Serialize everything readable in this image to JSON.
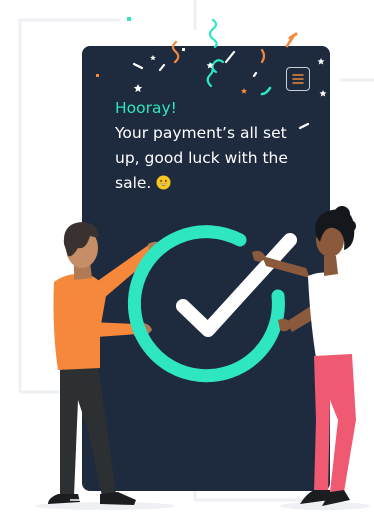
{
  "message": {
    "heading": "Hooray!",
    "body": "Your payment’s all set up, good luck with the sale."
  },
  "colors": {
    "card": "#1e2a3e",
    "accent": "#2ee6c1",
    "confetti_orange": "#f5883a"
  },
  "icons": {
    "menu": "hamburger-menu-icon",
    "emoji": "grinning-face-emoji-icon",
    "success": "check-circle-icon"
  }
}
